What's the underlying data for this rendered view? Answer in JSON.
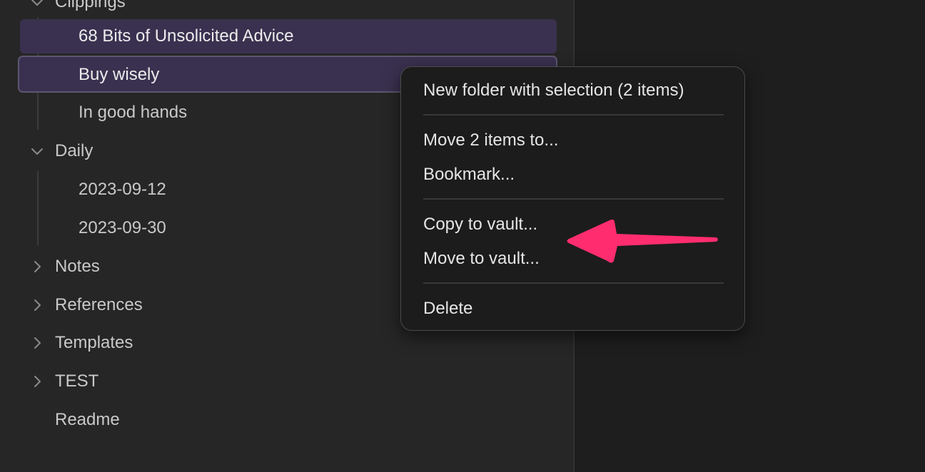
{
  "file_tree": {
    "top_folder_partial": "Clippings",
    "clippings_files": [
      {
        "label": "68 Bits of Unsolicited Advice"
      },
      {
        "label": "Buy wisely"
      },
      {
        "label": "In good hands"
      }
    ],
    "daily_folder": {
      "label": "Daily"
    },
    "daily_files": [
      {
        "label": "2023-09-12"
      },
      {
        "label": "2023-09-30"
      }
    ],
    "collapsed_folders": [
      {
        "label": "Notes"
      },
      {
        "label": "References"
      },
      {
        "label": "Templates"
      },
      {
        "label": "TEST"
      }
    ],
    "root_file": {
      "label": "Readme"
    }
  },
  "context_menu": {
    "new_folder": "New folder with selection (2 items)",
    "move_items": "Move 2 items to...",
    "bookmark": "Bookmark...",
    "copy_to_vault": "Copy to vault...",
    "move_to_vault": "Move to vault...",
    "delete": "Delete"
  },
  "colors": {
    "sidebar_bg": "#262626",
    "selection_bg": "#3a3150",
    "menu_bg": "#1c1c1c",
    "annotation_arrow": "#ff2d6f"
  },
  "icons": {
    "expanded": "chevron-down-icon",
    "collapsed": "chevron-right-icon",
    "annotation": "arrow-left-annotation"
  }
}
